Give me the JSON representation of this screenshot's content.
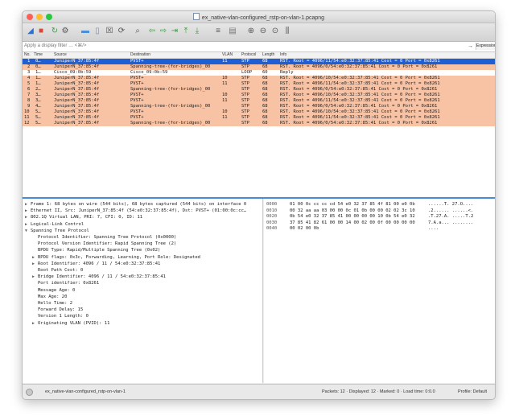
{
  "window": {
    "title": "ex_native-vlan-configured_rstp-on-vlan-1.pcapng"
  },
  "toolbar": {
    "icons": [
      "shark-fin-icon",
      "stop-icon",
      "restart-icon",
      "options-icon",
      "open-icon",
      "file-icon",
      "close-file-icon",
      "reload-icon",
      "find-icon",
      "back-icon",
      "forward-icon",
      "go-to-packet-icon",
      "first-packet-icon",
      "last-packet-icon",
      "autoscroll-icon",
      "colorize-icon",
      "zoom-in-icon",
      "zoom-out-icon",
      "normal-size-icon",
      "resize-columns-icon"
    ],
    "accent": "#2a6fd4"
  },
  "filter": {
    "placeholder": "Apply a display filter … <⌘/>",
    "arrow": "→",
    "expression_label": "Expression…"
  },
  "packet_list": {
    "columns": [
      "No.",
      "Time",
      "Source",
      "Destination",
      "VLAN",
      "Protocol",
      "Length",
      "Info"
    ],
    "rows": [
      {
        "no": "1",
        "time": "0…",
        "src": "JuniperN_37:85:4f",
        "dst": "PVST+",
        "vlan": "11",
        "proto": "STP",
        "len": "68",
        "info": "RST. Root = 4096/11/54:e0:32:37:85:41  Cost = 0  Port = 0x8261",
        "style": "sel"
      },
      {
        "no": "2",
        "time": "0…",
        "src": "JuniperN_37:85:4f",
        "dst": "Spanning-tree-(for-bridges)_00",
        "vlan": "",
        "proto": "STP",
        "len": "68",
        "info": "RST. Root = 4096/0/54:e0:32:37:85:41  Cost = 0  Port = 0x8261",
        "style": "stp"
      },
      {
        "no": "3",
        "time": "1…",
        "src": "Cisco_09:0b:59",
        "dst": "Cisco_09:0b:59",
        "vlan": "",
        "proto": "LOOP",
        "len": "60",
        "info": "Reply",
        "style": "loop"
      },
      {
        "no": "4",
        "time": "1…",
        "src": "JuniperN_37:85:4f",
        "dst": "PVST+",
        "vlan": "10",
        "proto": "STP",
        "len": "68",
        "info": "RST. Root = 4096/10/54:e0:32:37:85:41  Cost = 0  Port = 0x8261",
        "style": "stp"
      },
      {
        "no": "5",
        "time": "1…",
        "src": "JuniperN_37:85:4f",
        "dst": "PVST+",
        "vlan": "11",
        "proto": "STP",
        "len": "68",
        "info": "RST. Root = 4096/11/54:e0:32:37:85:41  Cost = 0  Port = 0x8261",
        "style": "stp"
      },
      {
        "no": "6",
        "time": "2…",
        "src": "JuniperN_37:85:4f",
        "dst": "Spanning-tree-(for-bridges)_00",
        "vlan": "",
        "proto": "STP",
        "len": "68",
        "info": "RST. Root = 4096/0/54:e0:32:37:85:41  Cost = 0  Port = 0x8261",
        "style": "stp"
      },
      {
        "no": "7",
        "time": "3…",
        "src": "JuniperN_37:85:4f",
        "dst": "PVST+",
        "vlan": "10",
        "proto": "STP",
        "len": "68",
        "info": "RST. Root = 4096/10/54:e0:32:37:85:41  Cost = 0  Port = 0x8261",
        "style": "stp"
      },
      {
        "no": "8",
        "time": "3…",
        "src": "JuniperN_37:85:4f",
        "dst": "PVST+",
        "vlan": "11",
        "proto": "STP",
        "len": "68",
        "info": "RST. Root = 4096/11/54:e0:32:37:85:41  Cost = 0  Port = 0x8261",
        "style": "stp"
      },
      {
        "no": "9",
        "time": "4…",
        "src": "JuniperN_37:85:4f",
        "dst": "Spanning-tree-(for-bridges)_00",
        "vlan": "",
        "proto": "STP",
        "len": "68",
        "info": "RST. Root = 4096/0/54:e0:32:37:85:41  Cost = 0  Port = 0x8261",
        "style": "stp"
      },
      {
        "no": "10",
        "time": "5…",
        "src": "JuniperN_37:85:4f",
        "dst": "PVST+",
        "vlan": "10",
        "proto": "STP",
        "len": "68",
        "info": "RST. Root = 4096/10/54:e0:32:37:85:41  Cost = 0  Port = 0x8261",
        "style": "stp"
      },
      {
        "no": "11",
        "time": "5…",
        "src": "JuniperN_37:85:4f",
        "dst": "PVST+",
        "vlan": "11",
        "proto": "STP",
        "len": "68",
        "info": "RST. Root = 4096/11/54:e0:32:37:85:41  Cost = 0  Port = 0x8261",
        "style": "stp"
      },
      {
        "no": "12",
        "time": "5…",
        "src": "JuniperN_37:85:4f",
        "dst": "Spanning-tree-(for-bridges)_00",
        "vlan": "",
        "proto": "STP",
        "len": "68",
        "info": "RST. Root = 4096/0/54:e0:32:37:85:41  Cost = 0  Port = 0x8261",
        "style": "stp"
      }
    ]
  },
  "details": {
    "rows": [
      {
        "t": "Frame 1: 68 bytes on wire (544 bits), 68 bytes captured (544 bits) on interface 0",
        "exp": "▶",
        "lvl": 0
      },
      {
        "t": "Ethernet II, Src: JuniperN_37:85:4f (54:e0:32:37:85:4f), Dst: PVST+ (01:00:0c:cc…",
        "exp": "▶",
        "lvl": 0
      },
      {
        "t": "802.1Q Virtual LAN, PRI: 7, CFI: 0, ID: 11",
        "exp": "▶",
        "lvl": 0
      },
      {
        "t": "Logical-Link Control",
        "exp": "▶",
        "lvl": 0
      },
      {
        "t": "Spanning Tree Protocol",
        "exp": "▼",
        "lvl": 0
      },
      {
        "t": "Protocol Identifier: Spanning Tree Protocol (0x0000)",
        "exp": "",
        "lvl": 1
      },
      {
        "t": "Protocol Version Identifier: Rapid Spanning Tree (2)",
        "exp": "",
        "lvl": 1
      },
      {
        "t": "BPDU Type: Rapid/Multiple Spanning Tree (0x02)",
        "exp": "",
        "lvl": 1
      },
      {
        "t": "BPDU flags: 0x3c, Forwarding, Learning, Port Role: Designated",
        "exp": "▶",
        "lvl": 1
      },
      {
        "t": "Root Identifier: 4096 / 11 / 54:e0:32:37:85:41",
        "exp": "▶",
        "lvl": 1
      },
      {
        "t": "Root Path Cost: 0",
        "exp": "",
        "lvl": 1
      },
      {
        "t": "Bridge Identifier: 4096 / 11 / 54:e0:32:37:85:41",
        "exp": "▶",
        "lvl": 1
      },
      {
        "t": "Port identifier: 0x8261",
        "exp": "",
        "lvl": 1
      },
      {
        "t": "Message Age: 0",
        "exp": "",
        "lvl": 1
      },
      {
        "t": "Max Age: 20",
        "exp": "",
        "lvl": 1
      },
      {
        "t": "Hello Time: 2",
        "exp": "",
        "lvl": 1
      },
      {
        "t": "Forward Delay: 15",
        "exp": "",
        "lvl": 1
      },
      {
        "t": "Version 1 Length: 0",
        "exp": "",
        "lvl": 1
      },
      {
        "t": "Originating VLAN (PVID): 11",
        "exp": "▶",
        "lvl": 1
      }
    ]
  },
  "bytes": {
    "rows": [
      {
        "off": "0000",
        "hex": "01 00 0c cc cc cd 54 e0  32 37 85 4f 81 00 e0 0b",
        "ascii": "......T. 27.O...."
      },
      {
        "off": "0010",
        "hex": "00 32 aa aa 03 00 00 0c  01 0b 00 00 02 02 3c 10",
        "ascii": ".2...... ......<."
      },
      {
        "off": "0020",
        "hex": "0b 54 e0 32 37 85 41 00  00 00 00 10 0b 54 e0 32",
        "ascii": ".T.27.A. .....T.2"
      },
      {
        "off": "0030",
        "hex": "37 85 41 82 61 00 00 14  00 02 00 0f 00 00 00 00",
        "ascii": "7.A.a... ........"
      },
      {
        "off": "0040",
        "hex": "00 02 00 0b",
        "ascii": "...."
      }
    ]
  },
  "status": {
    "file": "ex_native-vlan-configured_rstp-on-vlan-1",
    "counts": "Packets: 12 · Displayed: 12 · Marked: 0 · Load time: 0:0.0",
    "profile": "Profile: Default"
  }
}
